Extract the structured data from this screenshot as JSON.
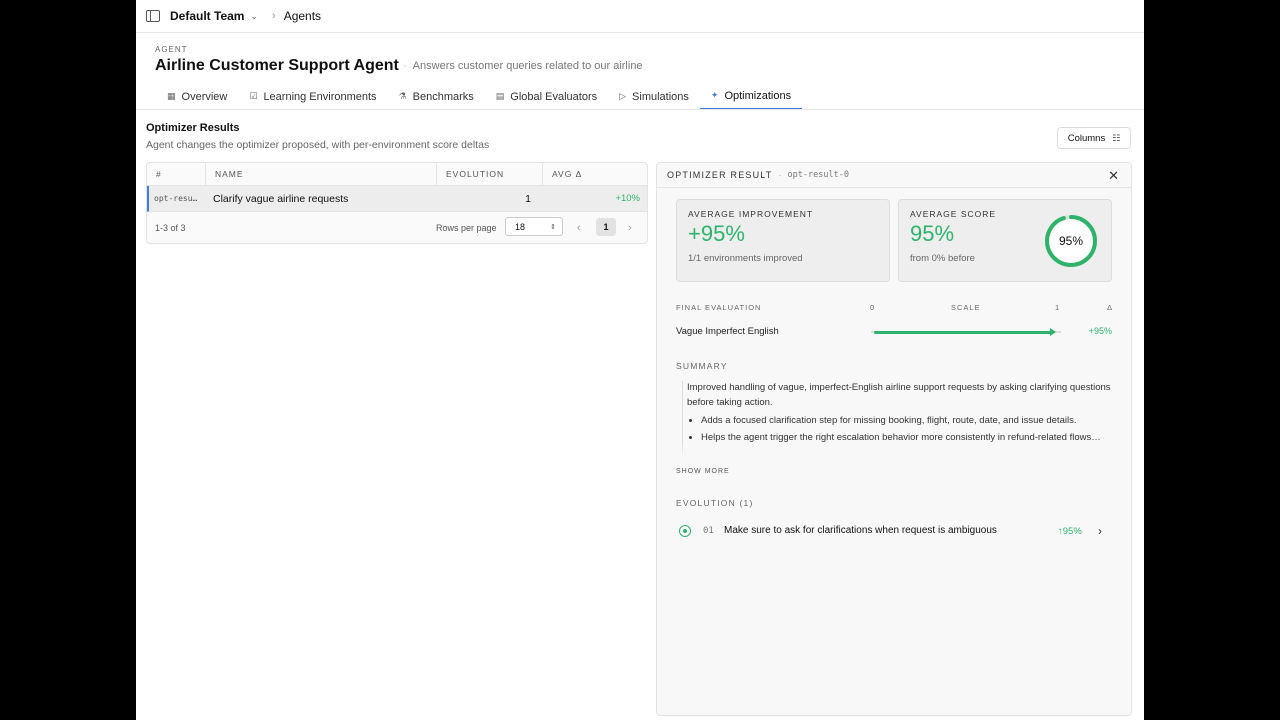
{
  "topbar": {
    "team": "Default Team",
    "breadcrumb": "Agents"
  },
  "agent": {
    "tag": "AGENT",
    "title": "Airline Customer Support Agent",
    "description": "Answers customer queries related to our airline"
  },
  "tabs": [
    {
      "label": "Overview",
      "icon": "grid-icon"
    },
    {
      "label": "Learning Environments",
      "icon": "checkbox-icon"
    },
    {
      "label": "Benchmarks",
      "icon": "beaker-icon"
    },
    {
      "label": "Global Evaluators",
      "icon": "document-icon"
    },
    {
      "label": "Simulations",
      "icon": "play-icon"
    },
    {
      "label": "Optimizations",
      "icon": "sparkle-icon",
      "active": true
    }
  ],
  "results": {
    "title": "Optimizer Results",
    "subtitle": "Agent changes the optimizer proposed, with per-environment score deltas",
    "columns_label": "Columns",
    "headers": [
      "#",
      "NAME",
      "EVOLUTION",
      "AVG Δ"
    ],
    "rows": [
      {
        "id": "opt-resu…",
        "name": "Clarify vague airline requests",
        "evolution": "1",
        "avg_delta": "+10%"
      }
    ],
    "footer": {
      "count": "1-3 of 3",
      "rows_per_page_label": "Rows per page",
      "rows_per_page": "18",
      "page": "1"
    }
  },
  "panel": {
    "title": "OPTIMIZER RESULT",
    "result_id": "opt-result-0",
    "avg_improvement": {
      "label": "AVERAGE IMPROVEMENT",
      "value": "+95%",
      "detail": "1/1 environments improved"
    },
    "avg_score": {
      "label": "AVERAGE SCORE",
      "value": "95%",
      "detail": "from 0% before",
      "ring_label": "95%",
      "fraction": 0.95
    },
    "final_eval": {
      "label": "FINAL EVALUATION",
      "scale_min": "0",
      "scale_label": "SCALE",
      "scale_max": "1",
      "delta_label": "Δ",
      "rows": [
        {
          "name": "Vague Imperfect English",
          "from": 0,
          "to": 0.95,
          "delta": "+95%"
        }
      ]
    },
    "summary": {
      "label": "SUMMARY",
      "text": "Improved handling of vague, imperfect-English airline support requests by asking clarifying questions before taking action.",
      "bullets": [
        "Adds a focused clarification step for missing booking, flight, route, date, and issue details.",
        "Helps the agent trigger the right escalation behavior more consistently in refund-related flows…"
      ],
      "show_more": "SHOW MORE"
    },
    "evolution": {
      "label": "EVOLUTION (1)",
      "items": [
        {
          "num": "01",
          "text": "Make sure to ask for clarifications when request is ambiguous",
          "delta": "↑95%"
        }
      ]
    }
  },
  "colors": {
    "accent": "#3f7ed8",
    "positive": "#2fb36a"
  }
}
